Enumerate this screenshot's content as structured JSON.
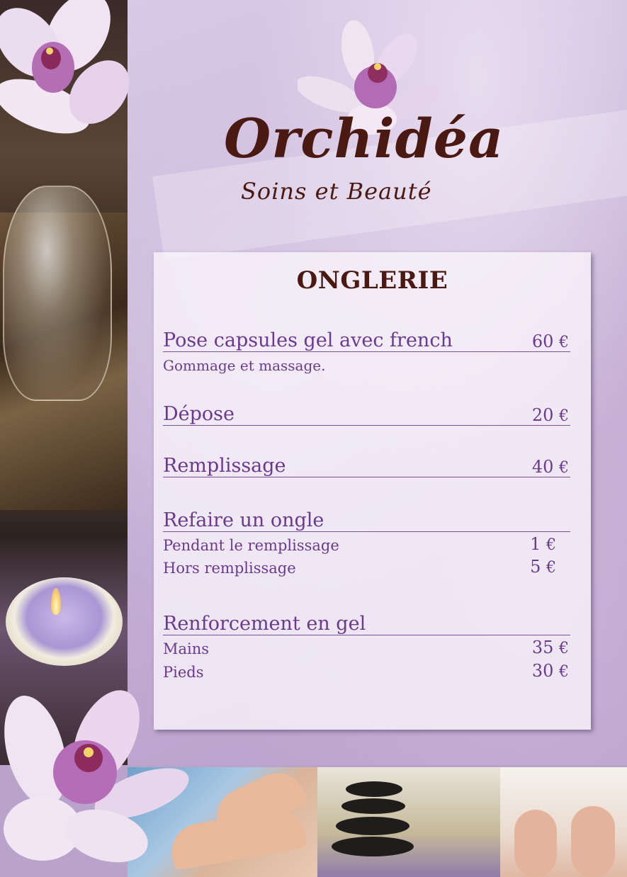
{
  "brand": {
    "name": "Orchidéa",
    "tagline": "Soins et Beauté"
  },
  "colors": {
    "brand_brown": "#4a1a12",
    "text_purple": "#6a3a8c",
    "line_purple": "#7d4fa0",
    "background_lilac": "#c6b1d6"
  },
  "menu": {
    "title": "ONGLERIE",
    "currency": "€",
    "items": [
      {
        "name": "Pose capsules gel avec french",
        "price": "60",
        "note": "Gommage et massage."
      },
      {
        "name": "Dépose",
        "price": "20"
      },
      {
        "name": "Remplissage",
        "price": "40"
      },
      {
        "name": "Refaire un ongle",
        "subitems": [
          {
            "name": "Pendant le remplissage",
            "price": "1"
          },
          {
            "name": "Hors remplissage",
            "price": "5"
          }
        ]
      },
      {
        "name": "Renforcement en gel",
        "subitems": [
          {
            "name": "Mains",
            "price": "35"
          },
          {
            "name": "Pieds",
            "price": "30"
          }
        ]
      }
    ]
  },
  "photos": [
    "orchid-photo",
    "teapot-photo",
    "candle-photo",
    "hands-photo",
    "stones-photo",
    "feet-photo"
  ]
}
